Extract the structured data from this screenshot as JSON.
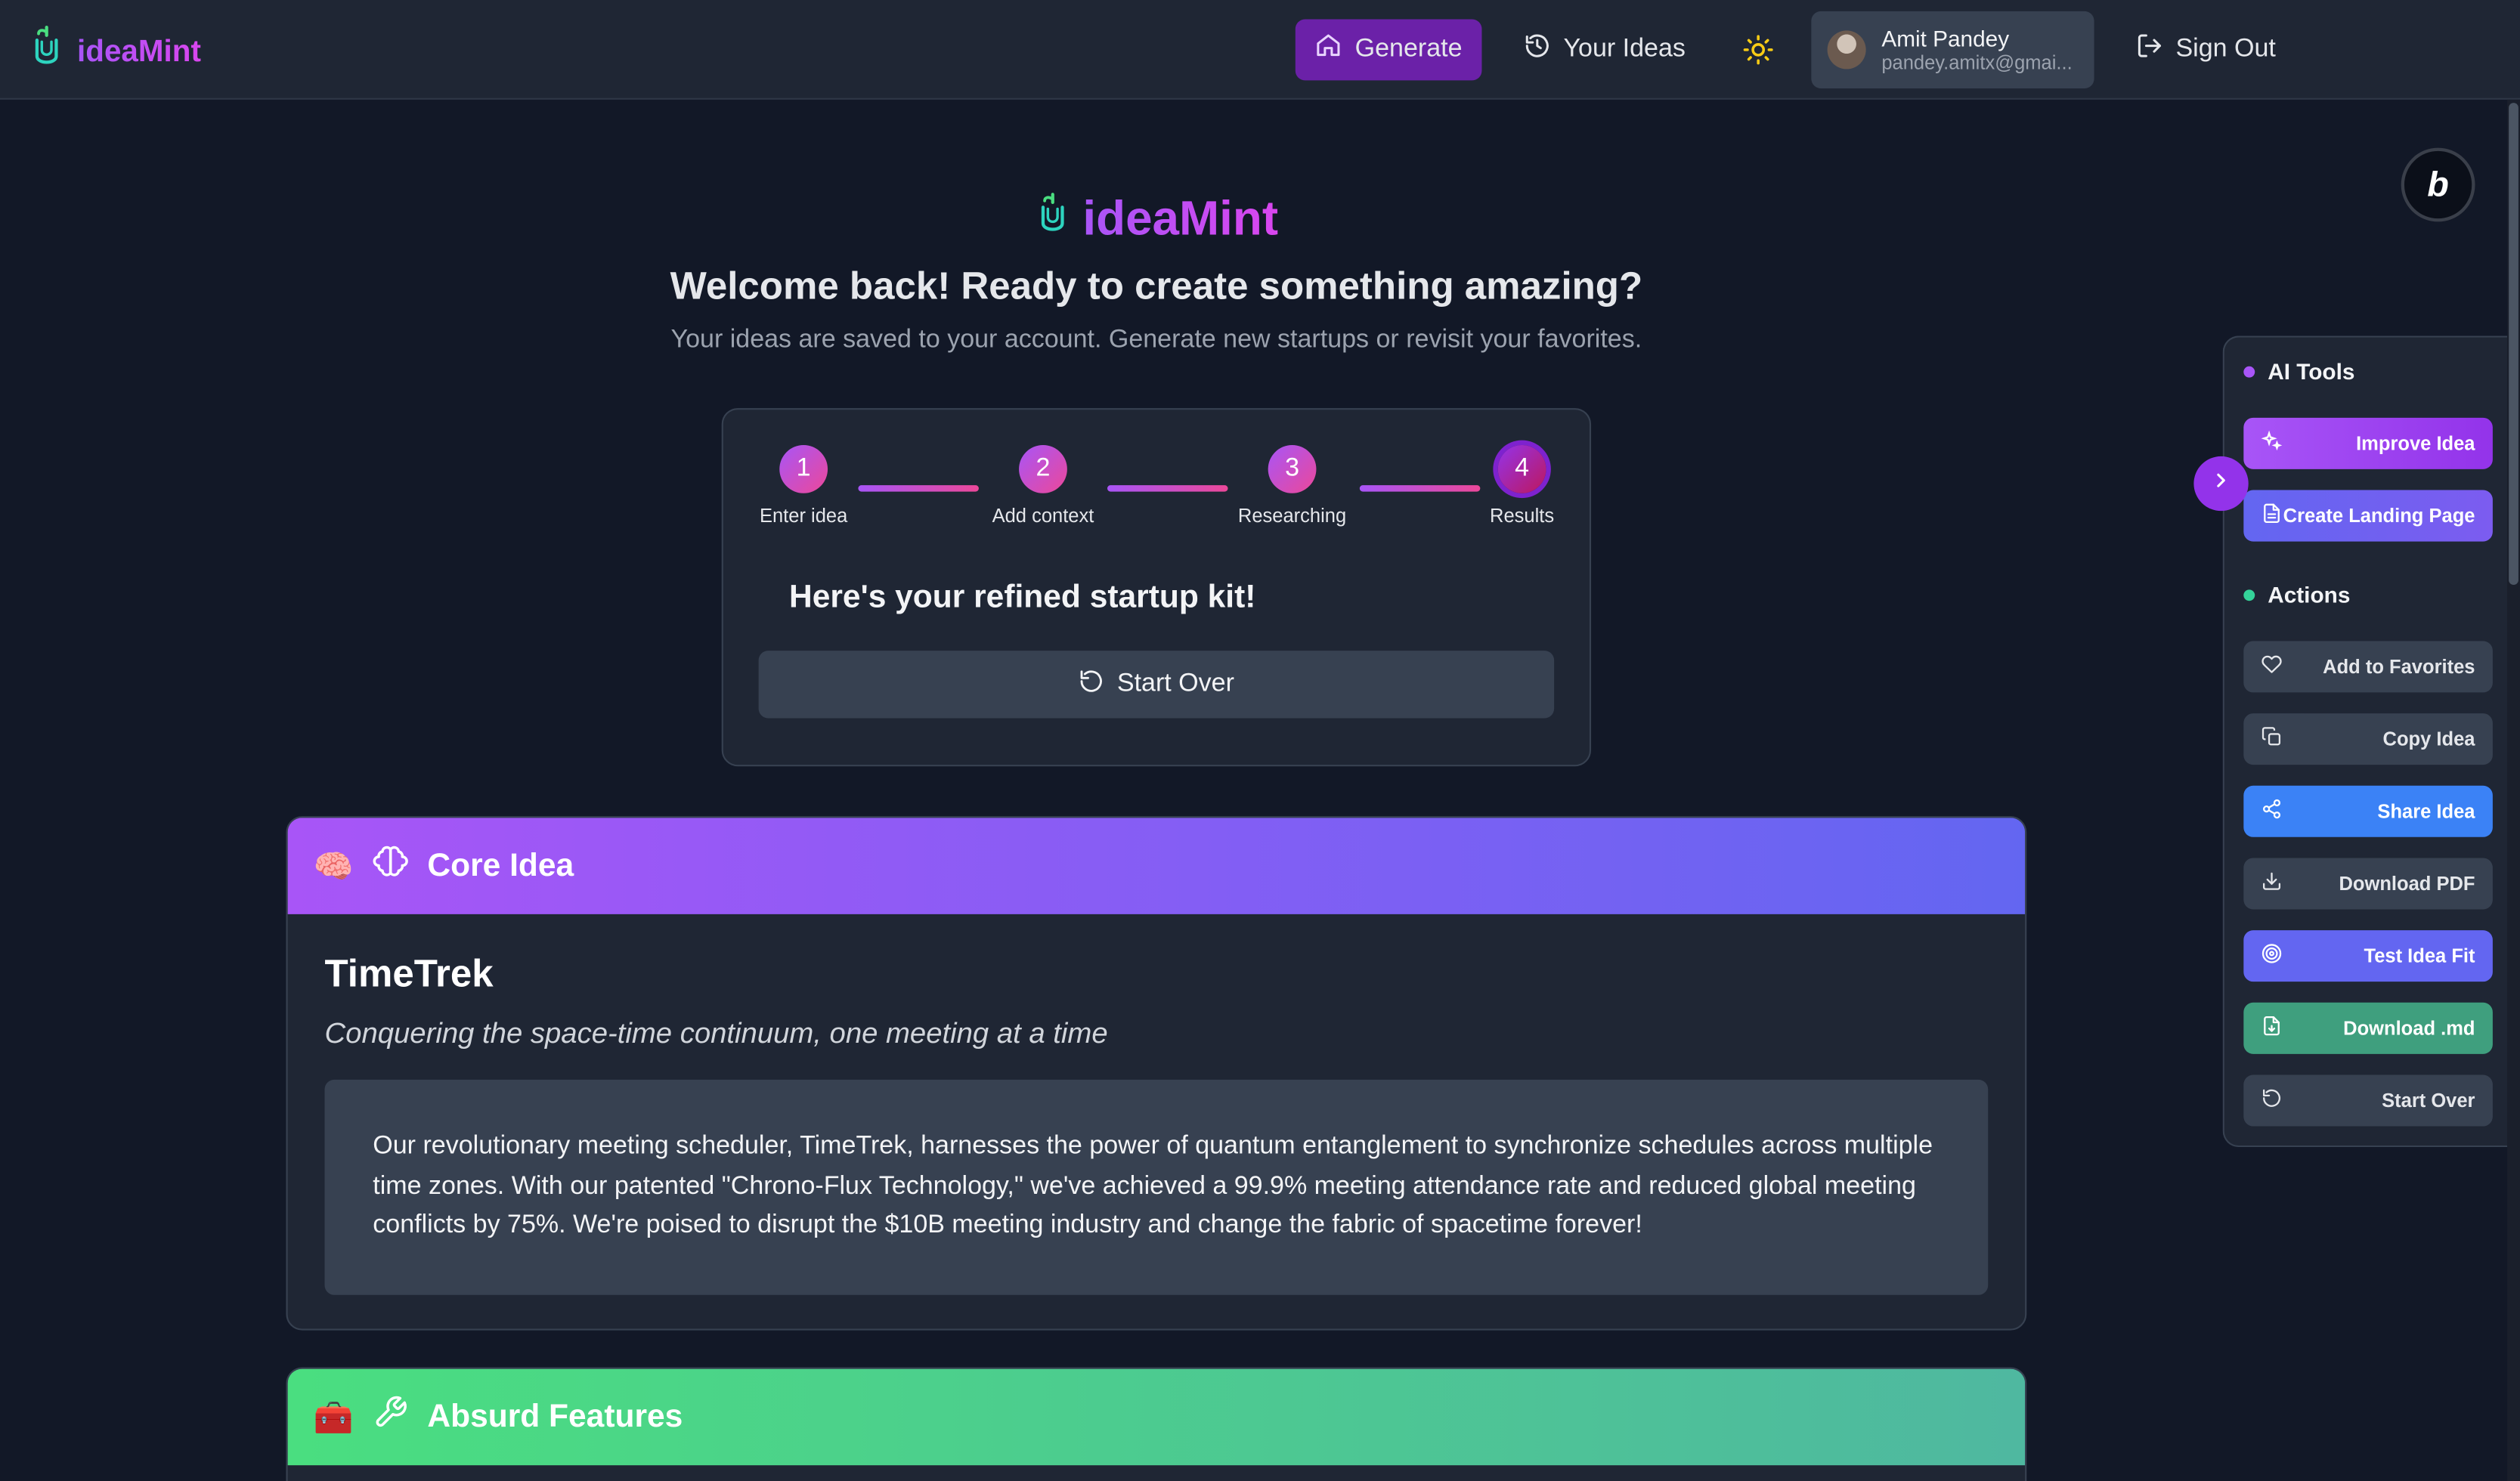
{
  "brand": {
    "name": "ideaMint"
  },
  "nav": {
    "generate_label": "Generate",
    "your_ideas_label": "Your Ideas",
    "user_name": "Amit Pandey",
    "user_email": "pandey.amitx@gmai...",
    "sign_out_label": "Sign Out"
  },
  "bolt_badge": {
    "letter": "b"
  },
  "hero": {
    "logo_text": "ideaMint",
    "title": "Welcome back! Ready to create something amazing?",
    "subtitle": "Your ideas are saved to your account. Generate new startups or revisit your favorites."
  },
  "stepper": {
    "steps": [
      {
        "number": "1",
        "label": "Enter idea"
      },
      {
        "number": "2",
        "label": "Add context"
      },
      {
        "number": "3",
        "label": "Researching"
      },
      {
        "number": "4",
        "label": "Results"
      }
    ],
    "kit_title": "Here's your refined startup kit!",
    "start_over_label": "Start Over"
  },
  "core_idea": {
    "emoji": "🧠",
    "heading": "Core Idea",
    "name": "TimeTrek",
    "tagline": "Conquering the space-time continuum, one meeting at a time",
    "description": "Our revolutionary meeting scheduler, TimeTrek, harnesses the power of quantum entanglement to synchronize schedules across multiple time zones. With our patented \"Chrono-Flux Technology,\" we've achieved a 99.9% meeting attendance rate and reduced global meeting conflicts by 75%. We're poised to disrupt the $10B meeting industry and change the fabric of spacetime forever!"
  },
  "absurd_features": {
    "emoji": "🧰",
    "heading": "Absurd Features"
  },
  "panel": {
    "ai_tools_heading": "AI Tools",
    "improve_idea": "Improve Idea",
    "create_landing_page": "Create Landing Page",
    "actions_heading": "Actions",
    "add_to_favorites": "Add to Favorites",
    "copy_idea": "Copy Idea",
    "share_idea": "Share Idea",
    "download_pdf": "Download PDF",
    "test_idea_fit": "Test Idea Fit",
    "download_md": "Download .md",
    "start_over": "Start Over"
  },
  "colors": {
    "background": "#121827",
    "accent_purple": "#a855f7",
    "accent_pink": "#ec4899",
    "share_blue": "#3b82f6",
    "test_indigo": "#6366f1",
    "download_md_green": "#3f9f7e"
  }
}
